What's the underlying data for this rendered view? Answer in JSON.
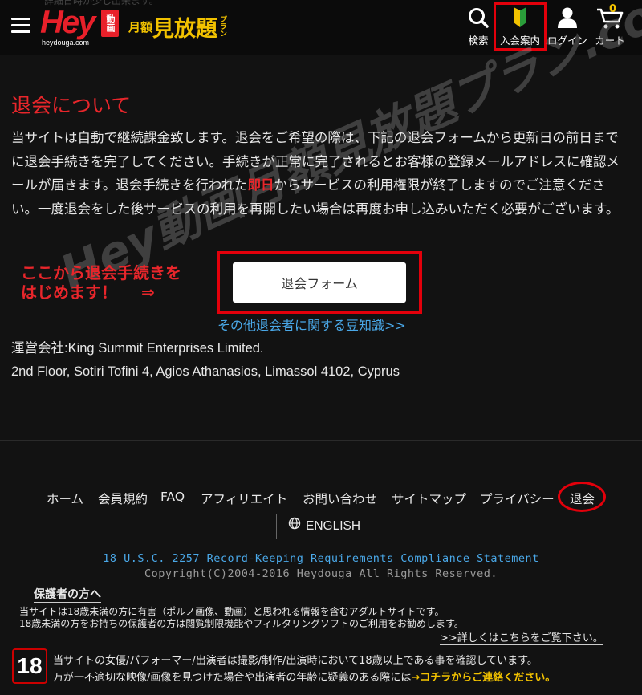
{
  "header": {
    "top_text": "詳細日時が少し出来ます。",
    "logo": {
      "main": "Hey",
      "badge": "動画",
      "domain": "heydouga.com"
    },
    "plan": {
      "small": "月額",
      "big": "見放題",
      "tiny": "プラン"
    },
    "nav": [
      {
        "label": "検索",
        "icon": "search-icon"
      },
      {
        "label": "入会案内",
        "icon": "beginner-mark-icon"
      },
      {
        "label": "ログイン",
        "icon": "user-icon"
      },
      {
        "label": "カート",
        "icon": "cart-icon",
        "count": "0"
      }
    ]
  },
  "main": {
    "title": "退会について",
    "desc_before": "当サイトは自動で継続課金致します。退会をご希望の際は、下記の退会フォームから更新日の前日までに退会手続きを完了してください。手続きが正常に完了されるとお客様の登録メールアドレスに確認メールが届きます。退会手続きを行われた",
    "desc_highlight": "即日",
    "desc_after": "からサービスの利用権限が終了しますのでご注意ください。一度退会をした後サービスの利用を再開したい場合は再度お申し込みいただく必要がございます。",
    "cta_line1": "ここから退会手続きを",
    "cta_line2": "はじめます！",
    "cta_arrow": "⇒",
    "form_button": "退会フォーム",
    "trivia_link": "その他退会者に関する豆知識>>",
    "company_line1": "運営会社:King Summit Enterprises Limited.",
    "company_line2": "2nd Floor, Sotiri Tofini 4, Agios Athanasios, Limassol 4102, Cyprus"
  },
  "watermark": "Hey動画月額見放題プラン.com",
  "footer": {
    "nav": [
      "ホーム",
      "会員規約",
      "FAQ",
      "アフィリエイト",
      "お問い合わせ",
      "サイトマップ",
      "プライバシー",
      "退会"
    ],
    "language": "ENGLISH",
    "usc": "18 U.S.C. 2257 Record-Keeping Requirements Compliance Statement",
    "copyright": "Copyright(C)2004-2016 Heydouga All Rights Reserved.",
    "guardian_title": "保護者の方へ",
    "guardian_line1": "当サイトは18歳未満の方に有害（ポルノ画像、動画）と思われる情報を含むアダルトサイトです。",
    "guardian_line2": "18歳未満の方をお持ちの保護者の方は閲覧制限機能やフィルタリングソフトのご利用をお勧めします。",
    "guardian_more": ">>詳しくはこちらをご覧下さい。",
    "badge": "18",
    "notice_line1": "当サイトの女優/パフォーマー/出演者は撮影/制作/出演時において18歳以上である事を確認しています。",
    "notice_line2": "万が一不適切な映像/画像を見つけた場合や出演者の年齢に疑義のある際には",
    "notice_contact": "→コチラからご連絡ください。"
  },
  "colors": {
    "accent_red": "#e8262b",
    "link_blue": "#4aa8e8",
    "brand_yellow": "#f2c200",
    "background": "#121212"
  }
}
